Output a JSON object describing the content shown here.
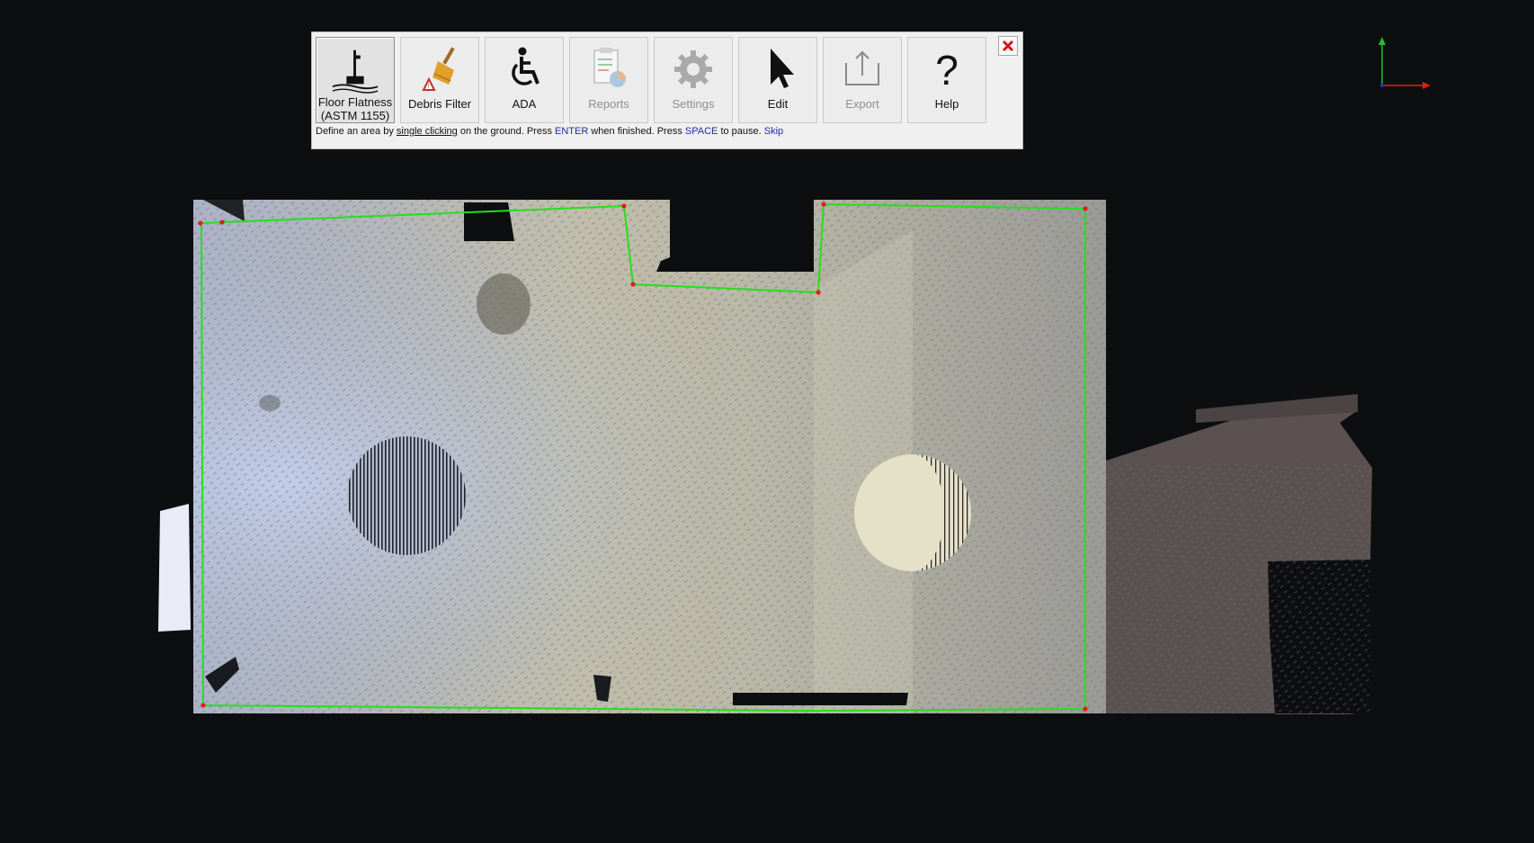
{
  "toolbar": {
    "tools": [
      {
        "label": "Floor Flatness\n(ASTM 1155)",
        "icon": "floor-flatness-icon",
        "state": "active"
      },
      {
        "label": "Debris Filter",
        "icon": "broom-icon",
        "state": "enabled"
      },
      {
        "label": "ADA",
        "icon": "wheelchair-icon",
        "state": "enabled"
      },
      {
        "label": "Reports",
        "icon": "report-chart-icon",
        "state": "disabled"
      },
      {
        "label": "Settings",
        "icon": "gear-icon",
        "state": "disabled"
      },
      {
        "label": "Edit",
        "icon": "cursor-arrow-icon",
        "state": "enabled"
      },
      {
        "label": "Export",
        "icon": "export-icon",
        "state": "disabled"
      },
      {
        "label": "Help",
        "icon": "question-icon",
        "state": "enabled"
      }
    ],
    "close_icon": "close-icon",
    "instruction": {
      "part1": "Define an area by ",
      "link1": "single clicking",
      "part2": " on the ground. Press ",
      "key1": "ENTER",
      "part3": " when finished. Press ",
      "key2": "SPACE",
      "part4": " to pause. ",
      "skip": "Skip"
    }
  },
  "axis_gizmo": {
    "x_color": "#e31b1b",
    "y_color": "#1fbf2a",
    "z_color": "#2033c8"
  },
  "colors": {
    "background": "#0d0e10",
    "boundary_line": "#22e01c",
    "vertex_marker": "#e11c1c",
    "close_x": "#d3141c",
    "link_text": "#1d2f9e"
  }
}
